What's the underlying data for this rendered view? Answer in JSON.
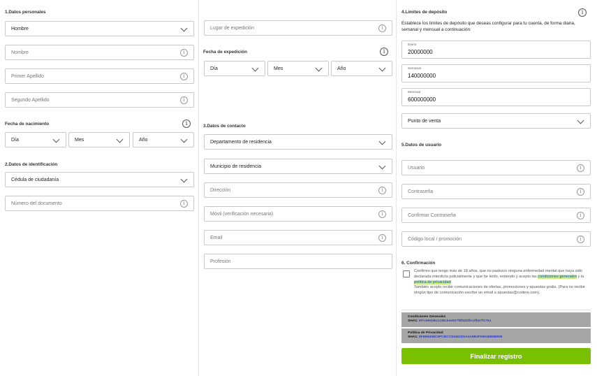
{
  "personal": {
    "title": "1.Datos personales",
    "gender": "Hombre",
    "name_placeholder": "Nombre",
    "first_surname_placeholder": "Primer Apellido",
    "second_surname_placeholder": "Segundo Apellido",
    "birth_title": "Fecha de nacimiento",
    "day": "Día",
    "month": "Mes",
    "year": "Año"
  },
  "identification": {
    "title": "2.Datos de identificación",
    "doc_type": "Cédula de ciudadanía",
    "doc_number_placeholder": "Número del documento",
    "place_placeholder": "Lugar de expedición",
    "issue_title": "Fecha de expedición",
    "day": "Día",
    "month": "Mes",
    "year": "Año"
  },
  "contact": {
    "title": "3.Datos de contacto",
    "department": "Departamento de residencia",
    "municipality": "Municipio de residencia",
    "address_placeholder": "Dirección",
    "mobile_placeholder": "Móvil (verificación necesaria)",
    "email_placeholder": "Email",
    "profession_placeholder": "Profesión"
  },
  "limits": {
    "title": "4.Límites de depósito",
    "description": "Establece los límites de depósito que deseas configurar para tu cuenta, de forma diaria, semanal y mensual a continuación:",
    "daily_label": "Diario",
    "daily_value": "20000000",
    "weekly_label": "Semanal",
    "weekly_value": "140000000",
    "monthly_label": "Mensual",
    "monthly_value": "600000000",
    "point_of_sale": "Punto de venta"
  },
  "user": {
    "title": "5.Datos de usuario",
    "username_placeholder": "Usuario",
    "password_placeholder": "Contraseña",
    "confirm_password_placeholder": "Confirmar Contraseña",
    "promo_placeholder": "Código local / promoción"
  },
  "confirmation": {
    "title": "6. Confirmación",
    "text_before": "Confirmo que tengo más de 18 años, que no padezco ninguna enfermedad mental que haya sido declarada interdicta judicialmente y que he leído, entiendo y acepto las ",
    "terms_link": "condiciones generales",
    "text_middle": " y la ",
    "privacy_link": "política de privacidad",
    "text_after": "También acepto recibir comunicaciones de ofertas, promociones y apuestas gratis. (Para no recibir ningún tipo de comunicación escribe un email a apuestas@codere.com).",
    "checked": false
  },
  "hashes": {
    "terms_title": "Condiciones Generales",
    "terms_prefix": "SHA1: ",
    "terms_hash": "9f7c99d46c1138c54e927f9f3d2fbc2fb67fc754",
    "privacy_title": "Política de Privacidad",
    "privacy_prefix": "SHA1: ",
    "privacy_hash": "8F8B6408C9FCBCC84462D5A4A8B3F65536B5B808"
  },
  "submit_label": "Finalizar registro",
  "colors": {
    "accent": "#79c000",
    "link": "#1a4fb3",
    "highlight": "#c9f07a"
  }
}
